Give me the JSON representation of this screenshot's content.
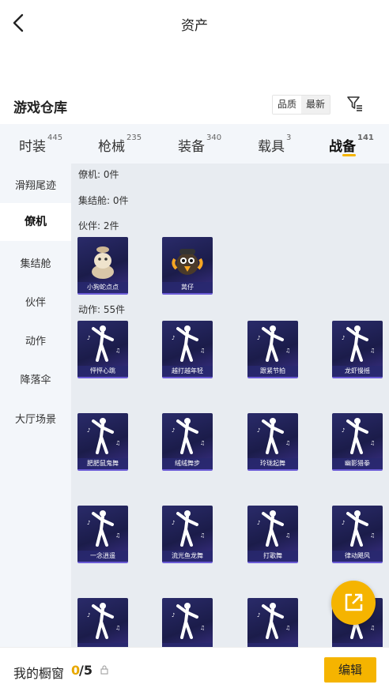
{
  "header": {
    "title": "资产",
    "back_icon": "chevron-left-icon"
  },
  "warehouse": {
    "title": "游戏仓库",
    "sort_options": [
      "品质",
      "最新"
    ],
    "active_sort": "最新",
    "filter_icon": "filter-icon"
  },
  "tabs": [
    {
      "label": "时装",
      "count": "445"
    },
    {
      "label": "枪械",
      "count": "235"
    },
    {
      "label": "装备",
      "count": "340"
    },
    {
      "label": "载具",
      "count": "3"
    },
    {
      "label": "战备",
      "count": "141",
      "active": true
    }
  ],
  "sidebar": {
    "items": [
      "滑翔尾迹",
      "僚机",
      "集结舱",
      "伙伴",
      "动作",
      "降落伞",
      "大厅场景"
    ],
    "active": "僚机"
  },
  "sections": {
    "wingman": "僚机: 0件",
    "pod": "集结舱: 0件",
    "partner": "伙伴: 2件",
    "emote": "动作: 55件"
  },
  "partners": [
    "小狗蛇点点",
    "莴仔"
  ],
  "emotes": [
    "怦怦心跳",
    "越打越年轻",
    "跟紧节拍",
    "龙虾慢摇",
    "肥肥鼠鬼舞",
    "绒绒舞步",
    "玲珑起舞",
    "幽影猎拳",
    "一念逍遥",
    "流光鱼龙舞",
    "打歌舞",
    "律动飓风",
    "",
    "",
    "",
    ""
  ],
  "showcase": {
    "title": "我的橱窗",
    "current": "0",
    "total": "/5",
    "edit_label": "编辑"
  },
  "colors": {
    "accent": "#f5b400",
    "card_bg": "#1f2055"
  },
  "float_button_icon": "share-external-icon"
}
